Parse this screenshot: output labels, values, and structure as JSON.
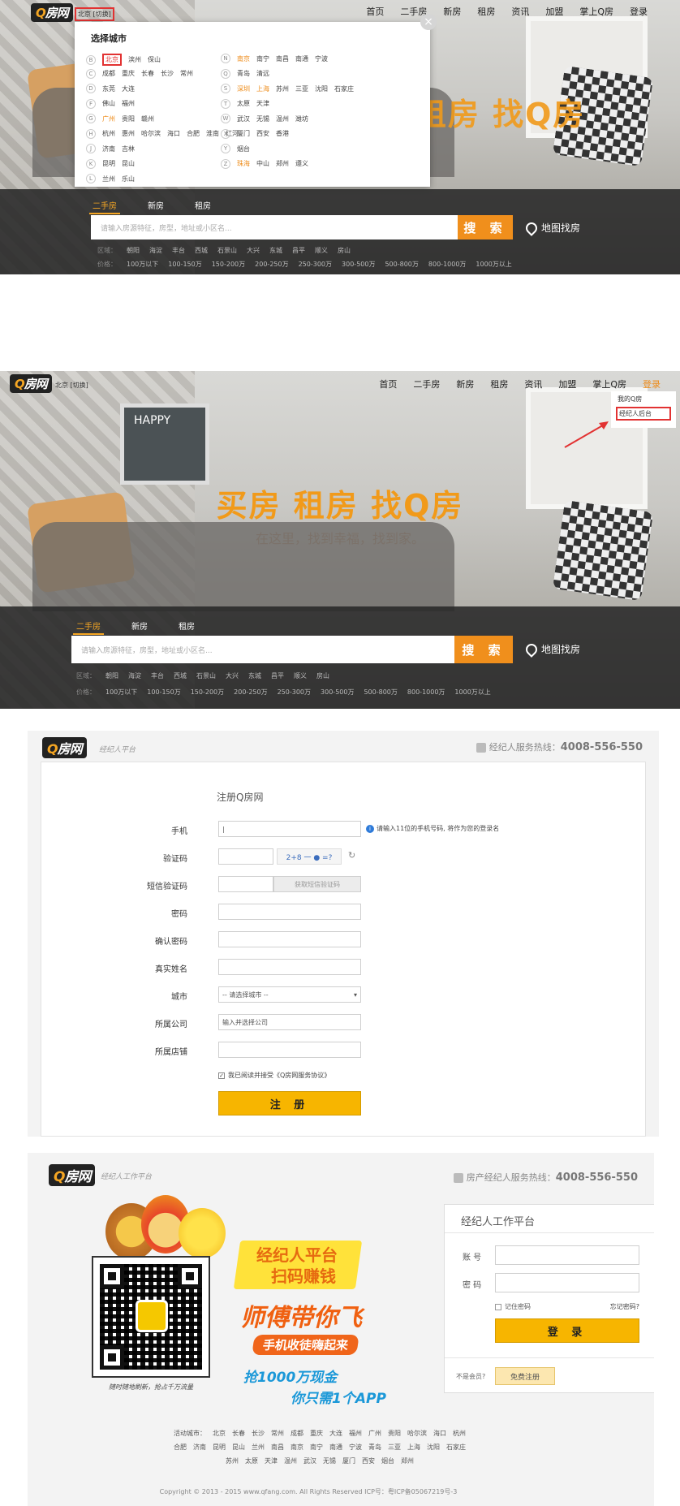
{
  "common": {
    "logo_q": "Q",
    "logo_text": "房网",
    "nav": [
      "首页",
      "二手房",
      "新房",
      "租房",
      "资讯",
      "加盟",
      "掌上Q房",
      "登录"
    ],
    "city_label": "北京 [切换]",
    "search_tabs": [
      "二手房",
      "新房",
      "租房"
    ],
    "search_placeholder": "请输入房源特征，房型，地址或小区名...",
    "search_button": "搜 索",
    "map_search": "地图找房",
    "area_label": "区域：",
    "areas": [
      "朝阳",
      "海淀",
      "丰台",
      "西城",
      "石景山",
      "大兴",
      "东城",
      "昌平",
      "顺义",
      "房山"
    ],
    "price_label": "价格：",
    "prices": [
      "100万以下",
      "100-150万",
      "150-200万",
      "200-250万",
      "250-300万",
      "300-500万",
      "500-800万",
      "800-1000万",
      "1000万以上"
    ]
  },
  "city_dropdown": {
    "title": "选择城市",
    "close": "×",
    "left": [
      {
        "letter": "B",
        "cities": [
          "北京",
          "滨州",
          "保山"
        ],
        "hl": [
          0
        ]
      },
      {
        "letter": "C",
        "cities": [
          "成都",
          "重庆",
          "长春",
          "长沙",
          "常州"
        ],
        "hl": []
      },
      {
        "letter": "D",
        "cities": [
          "东莞",
          "大连"
        ],
        "hl": []
      },
      {
        "letter": "F",
        "cities": [
          "佛山",
          "福州"
        ],
        "hl": []
      },
      {
        "letter": "G",
        "cities": [
          "广州",
          "贵阳",
          "赣州"
        ],
        "hl": [
          0
        ]
      },
      {
        "letter": "H",
        "cities": [
          "杭州",
          "惠州",
          "哈尔滨",
          "海口",
          "合肥",
          "淮南",
          "红河"
        ],
        "hl": []
      },
      {
        "letter": "J",
        "cities": [
          "济南",
          "吉林"
        ],
        "hl": []
      },
      {
        "letter": "K",
        "cities": [
          "昆明",
          "昆山"
        ],
        "hl": []
      },
      {
        "letter": "L",
        "cities": [
          "兰州",
          "乐山"
        ],
        "hl": []
      }
    ],
    "right": [
      {
        "letter": "N",
        "cities": [
          "南京",
          "南宁",
          "南昌",
          "南通",
          "宁波"
        ],
        "hl": [
          0
        ]
      },
      {
        "letter": "Q",
        "cities": [
          "青岛",
          "清远"
        ],
        "hl": []
      },
      {
        "letter": "S",
        "cities": [
          "深圳",
          "上海",
          "苏州",
          "三亚",
          "沈阳",
          "石家庄"
        ],
        "hl": [
          0,
          1
        ]
      },
      {
        "letter": "T",
        "cities": [
          "太原",
          "天津"
        ],
        "hl": []
      },
      {
        "letter": "W",
        "cities": [
          "武汉",
          "无锡",
          "温州",
          "潍坊"
        ],
        "hl": []
      },
      {
        "letter": "X",
        "cities": [
          "厦门",
          "西安",
          "香港"
        ],
        "hl": []
      },
      {
        "letter": "Y",
        "cities": [
          "烟台"
        ],
        "hl": []
      },
      {
        "letter": "Z",
        "cities": [
          "珠海",
          "中山",
          "郑州",
          "遵义"
        ],
        "hl": [
          0
        ]
      }
    ]
  },
  "hero2": {
    "slogan": "买房 租房 找Q房",
    "sub": "在这里，找到幸福，找到家。",
    "user_menu": [
      "我的Q房",
      "经纪人后台"
    ],
    "board_text": "HAPPY"
  },
  "register": {
    "platform": "经纪人平台",
    "hotline_label": "经纪人服务热线：",
    "hotline": "4008-556-550",
    "title": "注册Q房网",
    "labels": [
      "手机",
      "验证码",
      "短信验证码",
      "密码",
      "确认密码",
      "真实姓名",
      "城市",
      "所属公司",
      "所属店铺"
    ],
    "phone_hint": "请输入11位的手机号码, 将作为您的登录名",
    "captcha_text": "2+8 一 ● =?",
    "sms_button": "获取短信验证码",
    "city_select": "-- 请选择城市 --",
    "company_value": "输入并选择公司",
    "agree": "我已阅读并接受《Q房网服务协议》",
    "submit": "注 册"
  },
  "login": {
    "platform": "经纪人工作平台",
    "hotline_label": "房产经纪人服务热线：",
    "hotline": "4008-556-550",
    "promo1": "经纪人平台",
    "promo2": "扫码赚钱",
    "promo3": "师傅带你飞",
    "promo4": "手机收徒嗨起来",
    "promo5": "抢1000万现金",
    "promo6": "你只需1个APP",
    "qr_caption": "随时随地刷新，抢占千万流量",
    "box_title": "经纪人工作平台",
    "account_label": "账 号",
    "password_label": "密 码",
    "remember": "记住密码",
    "forgot": "忘记密码?",
    "login_button": "登 录",
    "not_member": "不是会员?",
    "free_register": "免费注册",
    "active_cities_label": "活动城市：",
    "city_row1": [
      "北京",
      "长春",
      "长沙",
      "常州",
      "成都",
      "重庆",
      "大连",
      "福州",
      "广州",
      "贵阳",
      "哈尔滨",
      "海口",
      "杭州"
    ],
    "city_row2": [
      "合肥",
      "济南",
      "昆明",
      "昆山",
      "兰州",
      "南昌",
      "南京",
      "南宁",
      "南通",
      "宁波",
      "青岛",
      "三亚",
      "上海",
      "沈阳",
      "石家庄"
    ],
    "city_row3": [
      "苏州",
      "太原",
      "天津",
      "温州",
      "武汉",
      "无锡",
      "厦门",
      "西安",
      "烟台",
      "郑州"
    ],
    "copyright": "Copyright © 2013 - 2015 www.qfang.com. All Rights Reserved ICP号：粤ICP备05067219号-3"
  }
}
